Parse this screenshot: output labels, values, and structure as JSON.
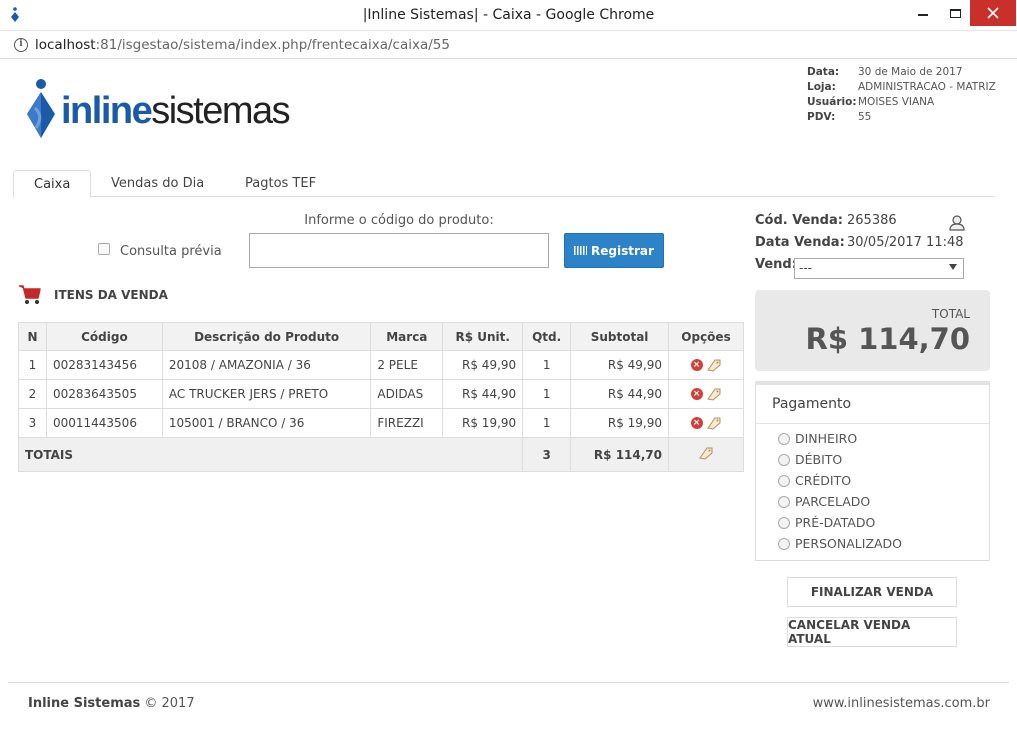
{
  "browser": {
    "title": "|Inline Sistemas| - Caixa - Google Chrome",
    "url_host": "localhost",
    "url_rest": ":81/isgestao/sistema/index.php/frentecaixa/caixa/55"
  },
  "header": {
    "logo_bold": "inline",
    "logo_light": "sistemas",
    "meta": [
      {
        "k": "Data:",
        "v": "30 de Maio de 2017"
      },
      {
        "k": "Loja:",
        "v": "ADMINISTRACAO - MATRIZ"
      },
      {
        "k": "Usuário:",
        "v": "MOISES VIANA"
      },
      {
        "k": "PDV:",
        "v": "55"
      }
    ]
  },
  "tabs": [
    "Caixa",
    "Vendas do Dia",
    "Pagtos TEF"
  ],
  "search": {
    "label": "Informe o código do produto:",
    "value": "",
    "placeholder": "",
    "consulta_label": "Consulta prévia",
    "register_label": "Registrar"
  },
  "itens_title": "ITENS DA VENDA",
  "table": {
    "headers": [
      "N",
      "Código",
      "Descrição do Produto",
      "Marca",
      "R$ Unit.",
      "Qtd.",
      "Subtotal",
      "Opções"
    ],
    "rows": [
      {
        "n": "1",
        "codigo": "00283143456",
        "descricao": "20108 / AMAZONIA / 36",
        "marca": "2 PELE",
        "unit": "R$ 49,90",
        "qtd": "1",
        "subtotal": "R$ 49,90"
      },
      {
        "n": "2",
        "codigo": "00283643505",
        "descricao": "AC TRUCKER JERS / PRETO",
        "marca": "ADIDAS",
        "unit": "R$ 44,90",
        "qtd": "1",
        "subtotal": "R$ 44,90"
      },
      {
        "n": "3",
        "codigo": "00011443506",
        "descricao": "105001 / BRANCO / 36",
        "marca": "FIREZZI",
        "unit": "R$ 19,90",
        "qtd": "1",
        "subtotal": "R$ 19,90"
      }
    ],
    "totals_label": "TOTAIS",
    "totals_qtd": "3",
    "totals_subtotal": "R$ 114,70"
  },
  "venda": {
    "cod_label": "Cód. Venda:",
    "cod_value": "265386",
    "data_label": "Data Venda:",
    "data_value": "30/05/2017 11:48",
    "vend_label": "Vend:",
    "vend_value": "---"
  },
  "total": {
    "label": "TOTAL",
    "value": "R$ 114,70"
  },
  "pagamento": {
    "title": "Pagamento",
    "options": [
      "DINHEIRO",
      "DÉBITO",
      "CRÉDITO",
      "PARCELADO",
      "PRÉ-DATADO",
      "PERSONALIZADO"
    ]
  },
  "actions": {
    "finalizar": "FINALIZAR VENDA",
    "cancelar": "CANCELAR VENDA ATUAL"
  },
  "footer": {
    "brand": "Inline Sistemas",
    "copy": " © 2017",
    "site": "www.inlinesistemas.com.br"
  },
  "colors": {
    "primary_button": "#2d83c7",
    "logo_blue": "#1a5aa8",
    "cart_red": "#c62828",
    "close_button": "#c9302c"
  }
}
